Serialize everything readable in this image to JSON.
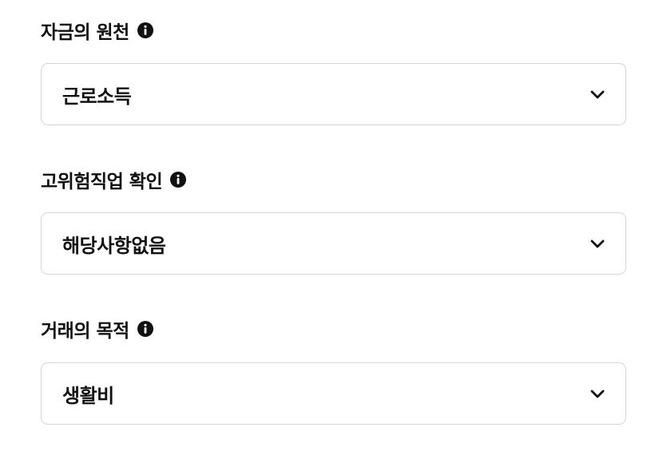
{
  "fields": [
    {
      "label": "자금의 원천",
      "value": "근로소득",
      "icon": "info-icon"
    },
    {
      "label": "고위험직업 확인",
      "value": "해당사항없음",
      "icon": "info-icon"
    },
    {
      "label": "거래의 목적",
      "value": "생활비",
      "icon": "info-icon"
    }
  ],
  "colors": {
    "text": "#111111",
    "border": "#d5d5d5",
    "background": "#ffffff"
  }
}
